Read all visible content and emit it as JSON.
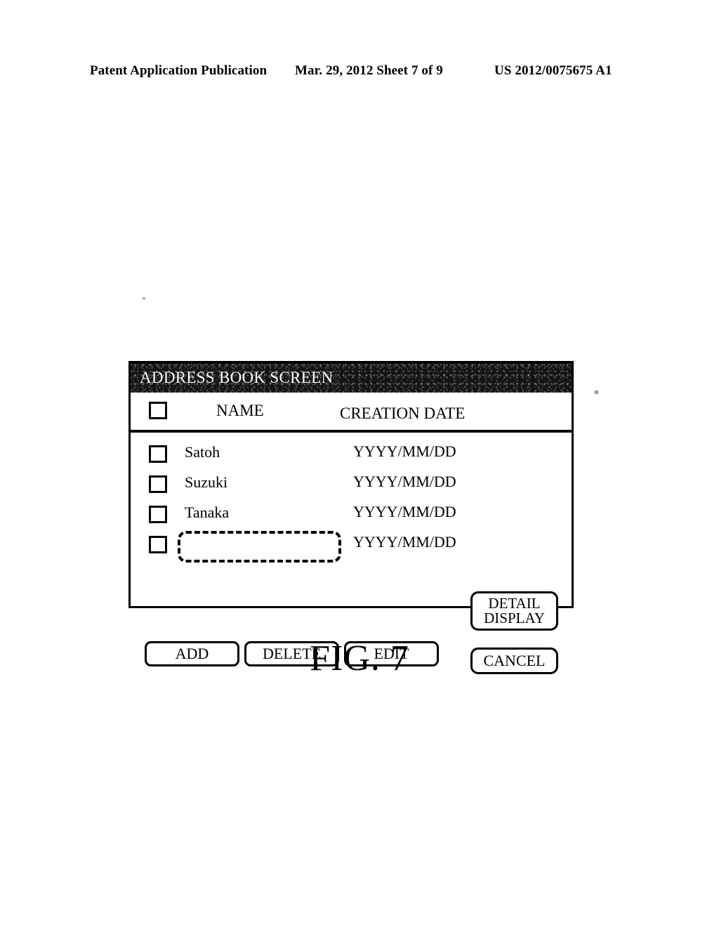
{
  "page_header": {
    "publication": "Patent Application Publication",
    "date_sheet": "Mar. 29, 2012  Sheet 7 of 9",
    "publication_number": "US 2012/0075675 A1"
  },
  "figure": {
    "caption": "FIG. 7"
  },
  "dialog": {
    "title": "ADDRESS BOOK SCREEN",
    "table": {
      "columns": [
        "",
        "NAME",
        "CREATION DATE"
      ],
      "header_checkbox": "select-all",
      "rows": [
        {
          "checkbox": "unchecked",
          "name": "Satoh",
          "date": "YYYY/MM/DD"
        },
        {
          "checkbox": "unchecked",
          "name": "Suzuki",
          "date": "YYYY/MM/DD"
        },
        {
          "checkbox": "unchecked",
          "name": "Tanaka",
          "date": "YYYY/MM/DD"
        },
        {
          "checkbox": "unchecked",
          "name": "",
          "date": "YYYY/MM/DD",
          "name_field_style": "dashed-empty"
        }
      ]
    },
    "buttons": {
      "detail_display_line1": "DETAIL",
      "detail_display_line2": "DISPLAY",
      "add": "ADD",
      "delete": "DELETE",
      "edit": "EDIT",
      "cancel": "CANCEL"
    }
  },
  "colors": {
    "ink": "#000000",
    "paper": "#ffffff",
    "titlebar": "#141414",
    "titlebar_text": "#ffffff"
  }
}
